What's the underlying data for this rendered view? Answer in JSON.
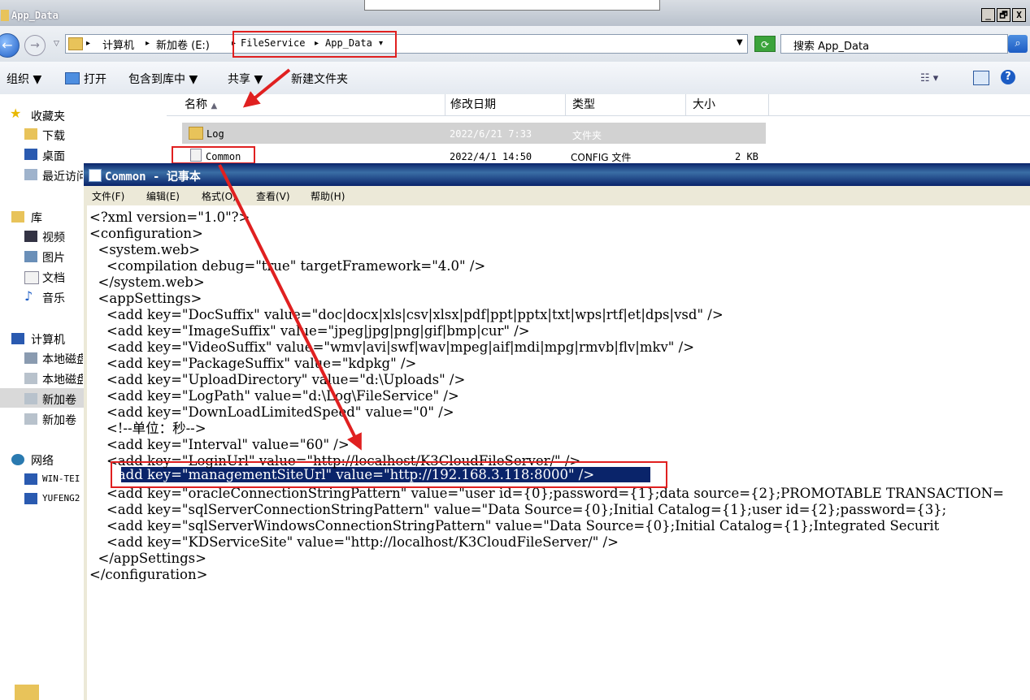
{
  "explorer": {
    "title": "App_Data",
    "caption_buttons": [
      "_",
      "🗗",
      "X"
    ],
    "breadcrumb": {
      "computer": "计算机",
      "drive": "新加卷 (E:)",
      "folder1": "FileService",
      "folder2": "App_Data"
    },
    "search_placeholder": "搜索 App_Data",
    "toolbar": {
      "organize": "组织 ▼",
      "open": "打开",
      "include_library": "包含到库中 ▼",
      "share": "共享 ▼",
      "new_folder": "新建文件夹"
    },
    "nav": {
      "favorites": "收藏夹",
      "downloads": "下载",
      "desktop": "桌面",
      "recent": "最近访问",
      "libraries": "库",
      "videos": "视频",
      "pictures": "图片",
      "documents": "文档",
      "music": "音乐",
      "computer": "计算机",
      "local1": "本地磁盘",
      "local2": "本地磁盘",
      "vol1": "新加卷",
      "vol2": "新加卷",
      "network": "网络",
      "net1": "WIN-TEI",
      "net2": "YUFENG2"
    },
    "columns": {
      "name": "名称",
      "modified": "修改日期",
      "type": "类型",
      "size": "大小"
    },
    "files": [
      {
        "name": "Log",
        "modified": "2022/6/21 7:33",
        "type": "文件夹",
        "size": ""
      },
      {
        "name": "Common",
        "modified": "2022/4/1 14:50",
        "type": "CONFIG 文件",
        "size": "2 KB"
      }
    ]
  },
  "notepad": {
    "title": "Common - 记事本",
    "menu": [
      "文件(F)",
      "编辑(E)",
      "格式(O)",
      "查看(V)",
      "帮助(H)"
    ],
    "lines": [
      "<?xml version=\"1.0\"?>",
      "<configuration>",
      "  <system.web>",
      "    <compilation debug=\"true\" targetFramework=\"4.0\" />",
      "  </system.web>",
      "  <appSettings>",
      "    <add key=\"DocSuffix\" value=\"doc|docx|xls|csv|xlsx|pdf|ppt|pptx|txt|wps|rtf|et|dps|vsd\" />",
      "    <add key=\"ImageSuffix\" value=\"jpeg|jpg|png|gif|bmp|cur\" />",
      "    <add key=\"VideoSuffix\" value=\"wmv|avi|swf|wav|mpeg|aif|mdi|mpg|rmvb|flv|mkv\" />",
      "    <add key=\"PackageSuffix\" value=\"kdpkg\" />",
      "    <add key=\"UploadDirectory\" value=\"d:\\Uploads\" />",
      "    <add key=\"LogPath\" value=\"d:\\Log\\FileService\" />",
      "    <add key=\"DownLoadLimitedSpeed\" value=\"0\" />",
      "    <!--单位：秒-->",
      "    <add key=\"Interval\" value=\"60\" />",
      "    <add key=\"LoginUrl\" value=\"http://localhost/K3CloudFileServer/\" />",
      "    <add key=\"managementSiteUrl\" value=\"http://192.168.3.118:8000\" />",
      "    <add key=\"oracleConnectionStringPattern\" value=\"user id={0};password={1};data source={2};PROMOTABLE TRANSACTION=",
      "    <add key=\"sqlServerConnectionStringPattern\" value=\"Data Source={0};Initial Catalog={1};user id={2};password={3};",
      "    <add key=\"sqlServerWindowsConnectionStringPattern\" value=\"Data Source={0};Initial Catalog={1};Integrated Securit",
      "    <add key=\"KDServiceSite\" value=\"http://localhost/K3CloudFileServer/\" />",
      "  </appSettings>",
      "</configuration>"
    ]
  },
  "colors": {
    "annotation_red": "#e02020",
    "selection": "#0a246a",
    "titlebar": "#0a246a"
  }
}
